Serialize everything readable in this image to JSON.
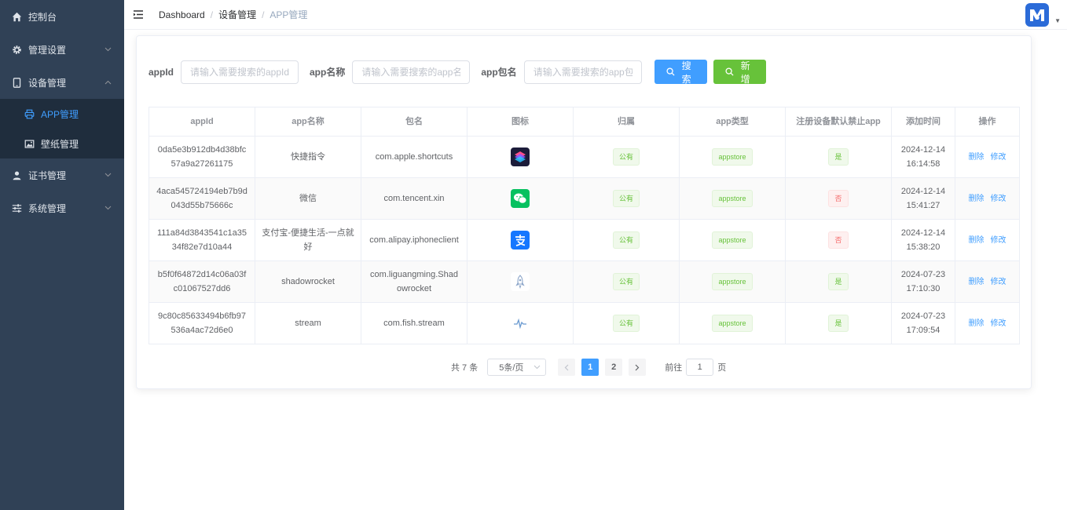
{
  "sidebar": {
    "items": [
      {
        "label": "控制台",
        "icon": "home-icon"
      },
      {
        "label": "管理设置",
        "icon": "gear-icon"
      },
      {
        "label": "设备管理",
        "icon": "tablet-icon"
      },
      {
        "label": "证书管理",
        "icon": "user-icon"
      },
      {
        "label": "系统管理",
        "icon": "sliders-icon"
      }
    ],
    "sub_items": [
      {
        "label": "APP管理",
        "icon": "printer-icon",
        "active": true
      },
      {
        "label": "壁纸管理",
        "icon": "picture-icon",
        "active": false
      }
    ]
  },
  "header": {
    "breadcrumb": [
      "Dashboard",
      "设备管理",
      "APP管理"
    ],
    "separator": "/"
  },
  "search": {
    "appid_label": "appId",
    "appid_placeholder": "请输入需要搜索的appId",
    "name_label": "app名称",
    "name_placeholder": "请输入需要搜索的app名称",
    "package_label": "app包名",
    "package_placeholder": "请输入需要搜索的app包名",
    "search_button": "搜索",
    "add_button": "新增"
  },
  "table": {
    "columns": [
      "appId",
      "app名称",
      "包名",
      "图标",
      "归属",
      "app类型",
      "注册设备默认禁止app",
      "添加时间",
      "操作"
    ],
    "rows": [
      {
        "appid": "0da5e3b912db4d38bfc57a9a27261175",
        "name": "快捷指令",
        "package": "com.apple.shortcuts",
        "icon": "shortcuts-icon",
        "owner": "公有",
        "type": "appstore",
        "forbid": "是",
        "forbid_status": "yes",
        "time": "2024-12-14 16:14:58"
      },
      {
        "appid": "4aca545724194eb7b9d043d55b75666c",
        "name": "微信",
        "package": "com.tencent.xin",
        "icon": "wechat-icon",
        "owner": "公有",
        "type": "appstore",
        "forbid": "否",
        "forbid_status": "no",
        "time": "2024-12-14 15:41:27"
      },
      {
        "appid": "111a84d3843541c1a3534f82e7d10a44",
        "name": "支付宝-便捷生活-一点就好",
        "package": "com.alipay.iphoneclient",
        "icon": "alipay-icon",
        "owner": "公有",
        "type": "appstore",
        "forbid": "否",
        "forbid_status": "no",
        "time": "2024-12-14 15:38:20"
      },
      {
        "appid": "b5f0f64872d14c06a03fc01067527dd6",
        "name": "shadowrocket",
        "package": "com.liguangming.Shadowrocket",
        "icon": "rocket-icon",
        "owner": "公有",
        "type": "appstore",
        "forbid": "是",
        "forbid_status": "yes",
        "time": "2024-07-23 17:10:30"
      },
      {
        "appid": "9c80c85633494b6fb97536a4ac72d6e0",
        "name": "stream",
        "package": "com.fish.stream",
        "icon": "pulse-icon",
        "owner": "公有",
        "type": "appstore",
        "forbid": "是",
        "forbid_status": "yes",
        "time": "2024-07-23 17:09:54"
      }
    ],
    "op_delete": "删除",
    "op_edit": "修改"
  },
  "pagination": {
    "total": "共 7 条",
    "page_size": "5条/页",
    "pages": [
      "1",
      "2"
    ],
    "current_page": "1",
    "goto_label": "前往",
    "goto_value": "1",
    "goto_suffix": "页"
  },
  "colors": {
    "sidebar_bg": "#304156",
    "submenu_bg": "#1f2d3d",
    "primary": "#409eff",
    "success": "#67c23a",
    "danger": "#f56c6c"
  }
}
